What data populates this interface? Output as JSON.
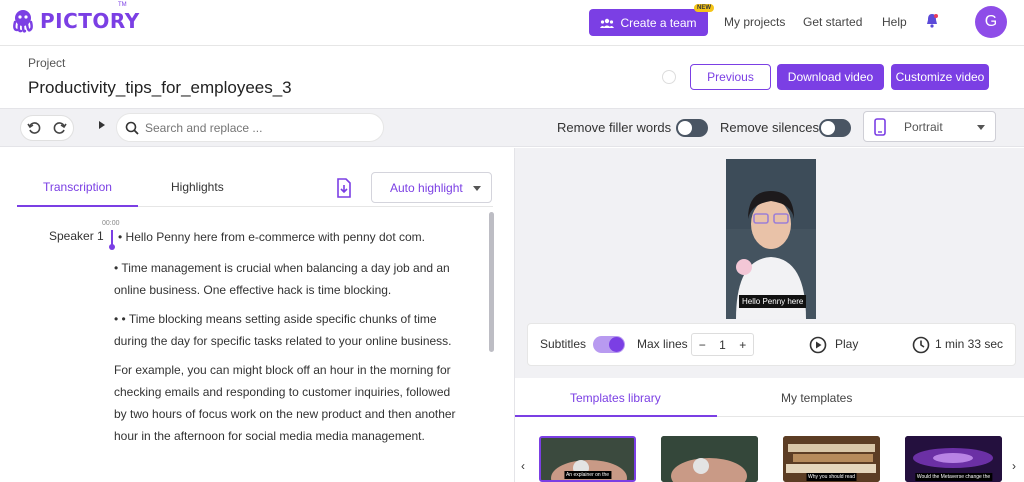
{
  "brand": {
    "name": "PICTORY",
    "tm": "TM",
    "accent": "#7b3fe4"
  },
  "nav": {
    "create_team": "Create a team",
    "new_badge": "NEW",
    "my_projects": "My projects",
    "get_started": "Get started",
    "help": "Help",
    "avatar_initial": "G"
  },
  "project": {
    "label": "Project",
    "title": "Productivity_tips_for_employees_3",
    "previous": "Previous",
    "download": "Download video",
    "customize": "Customize video"
  },
  "toolbar": {
    "search_placeholder": "Search and replace ...",
    "remove_filler": "Remove filler words",
    "remove_silences": "Remove silences",
    "orientation": "Portrait"
  },
  "transcript": {
    "tab_transcription": "Transcription",
    "tab_highlights": "Highlights",
    "auto_highlight": "Auto highlight",
    "speaker": "Speaker 1",
    "timestamp": "00:00",
    "paragraphs": [
      "• Hello Penny here from e-commerce with penny dot com.",
      "• Time management is crucial when balancing a day job and an online business. One effective hack is time blocking.",
      "• • Time blocking means setting aside specific chunks of time during the day for specific tasks related to your online business.",
      "For example, you can might block off an hour in the morning for checking emails and responding to customer inquiries, followed by two hours of focus work on the new product and then another hour in the afternoon for social media media management."
    ]
  },
  "preview": {
    "subtitle_text": "Hello Penny here",
    "subtitles_label": "Subtitles",
    "max_lines_label": "Max lines",
    "max_lines_value": "1",
    "minus": "−",
    "plus": "+",
    "play": "Play",
    "duration": "1 min 33 sec"
  },
  "templates": {
    "tab_library": "Templates library",
    "tab_mine": "My templates",
    "items": [
      {
        "caption": "An explainer on the"
      },
      {
        "caption": ""
      },
      {
        "caption": "Why you should read"
      },
      {
        "caption": "Would the Metaverse change the"
      }
    ]
  }
}
